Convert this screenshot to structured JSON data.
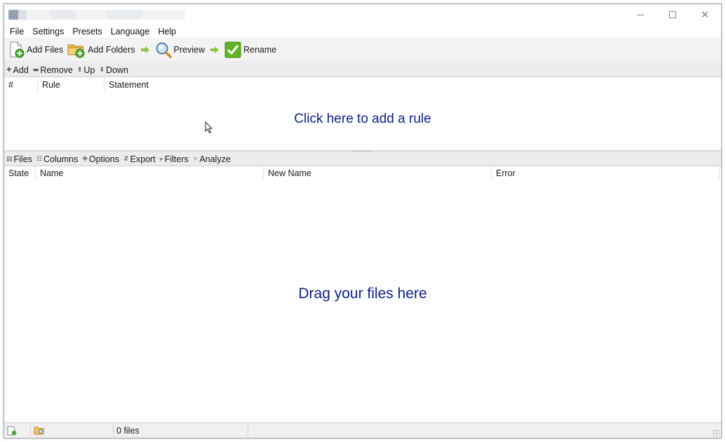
{
  "menu": {
    "items": [
      "File",
      "Settings",
      "Presets",
      "Language",
      "Help"
    ]
  },
  "toolbar": {
    "add_files": "Add Files",
    "add_folders": "Add Folders",
    "preview": "Preview",
    "rename": "Rename"
  },
  "rules_toolbar": {
    "add": "Add",
    "remove": "Remove",
    "up": "Up",
    "down": "Down"
  },
  "rules_table": {
    "columns": [
      "#",
      "Rule",
      "Statement"
    ],
    "empty_hint": "Click here to add a rule"
  },
  "files_toolbar": {
    "files": "Files",
    "columns": "Columns",
    "options": "Options",
    "export": "Export",
    "filters": "Filters",
    "analyze": "Analyze"
  },
  "files_table": {
    "columns": [
      "State",
      "Name",
      "New Name",
      "Error"
    ],
    "empty_hint": "Drag your files here"
  },
  "status": {
    "file_count": "0 files"
  },
  "colors": {
    "hint_text": "#0d1f8c",
    "arrow_green": "#8cc63f",
    "rename_green": "#5db524"
  },
  "icons": {
    "add_files": "add-file-icon",
    "add_folders": "add-folder-icon",
    "preview": "magnifier-icon",
    "rename": "checkmark-icon"
  }
}
